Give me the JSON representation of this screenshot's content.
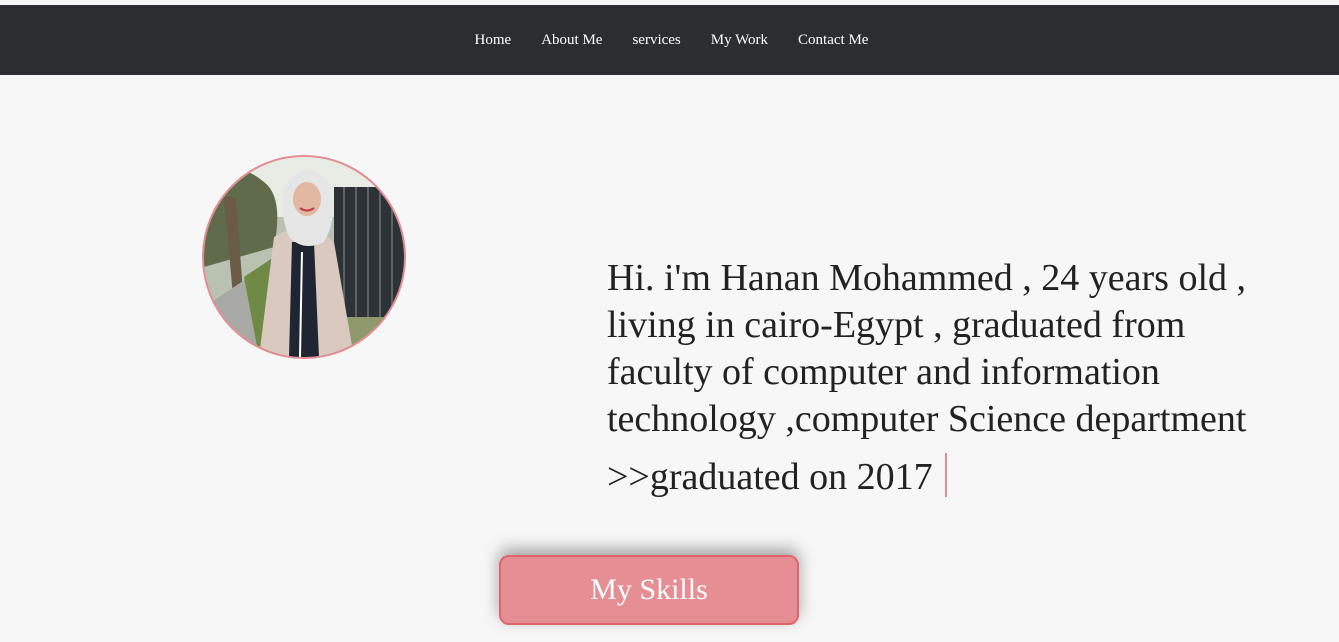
{
  "nav": {
    "items": [
      {
        "label": "Home"
      },
      {
        "label": "About Me"
      },
      {
        "label": "services"
      },
      {
        "label": "My Work"
      },
      {
        "label": "Contact Me"
      }
    ]
  },
  "hero": {
    "bio_lines": [
      "Hi. i'm Hanan Mohammed , 24 years old ,",
      "living in cairo-Egypt , graduated from",
      "faculty of computer and information",
      "technology ,computer Science department",
      ">>graduated on 2017"
    ],
    "skills_button": "My Skills"
  },
  "colors": {
    "navbar": "#2b2d30",
    "accent": "#e58f95",
    "accent_border": "#e0646d",
    "background": "#f7f7f7"
  }
}
